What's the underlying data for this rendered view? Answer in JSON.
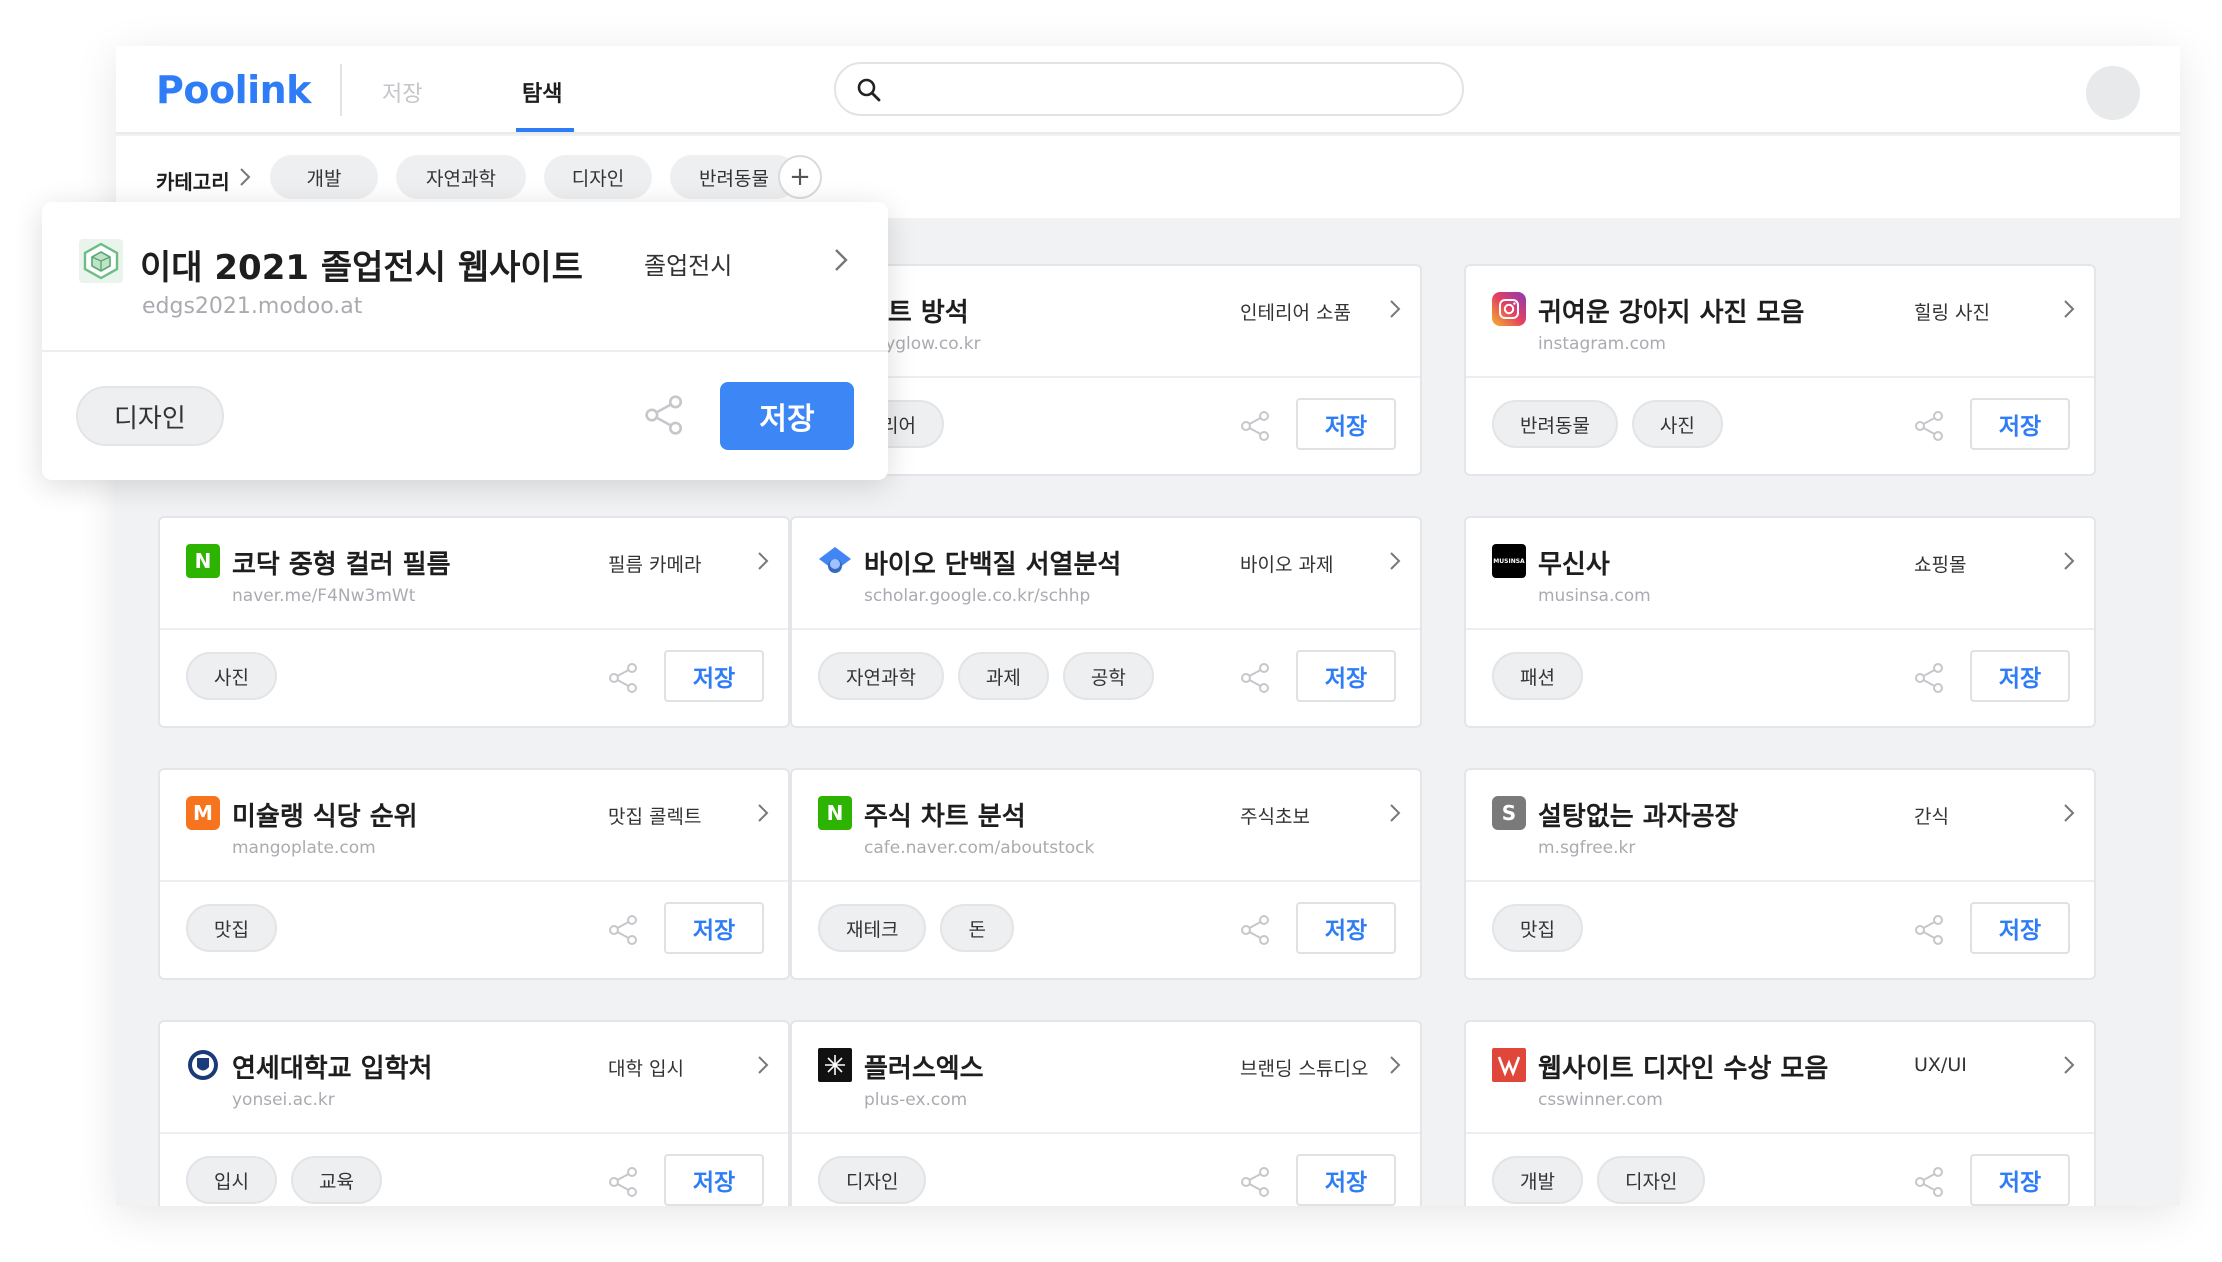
{
  "header": {
    "logo": "Poolink",
    "tabs": {
      "save": "저장",
      "explore": "탐색"
    },
    "search_placeholder": ""
  },
  "category_bar": {
    "label": "카테고리",
    "pills": [
      "개발",
      "자연과학",
      "디자인",
      "반려동물"
    ],
    "add_label": "+"
  },
  "popup": {
    "title": "이대 2021 졸업전시 웹사이트",
    "url": "edgs2021.modoo.at",
    "category": "졸업전시",
    "tag": "디자인",
    "save_label": "저장"
  },
  "cards": [
    {
      "title": "보트 방석",
      "url": "dayglow.co.kr",
      "category": "인테리어 소품",
      "tags": [
        "인테리어"
      ],
      "save": "저장"
    },
    {
      "title": "귀여운 강아지 사진 모음",
      "url": "instagram.com",
      "category": "힐링 사진",
      "tags": [
        "반려동물",
        "사진"
      ],
      "save": "저장"
    },
    {
      "title": "코닥 중형 컬러 필름",
      "url": "naver.me/F4Nw3mWt",
      "category": "필름 카메라",
      "tags": [
        "사진"
      ],
      "save": "저장",
      "icon_text": "N"
    },
    {
      "title": "바이오 단백질 서열분석",
      "url": "scholar.google.co.kr/schhp",
      "category": "바이오 과제",
      "tags": [
        "자연과학",
        "과제",
        "공학"
      ],
      "save": "저장"
    },
    {
      "title": "무신사",
      "url": "musinsa.com",
      "category": "쇼핑몰",
      "tags": [
        "패션"
      ],
      "save": "저장",
      "icon_text": "MUSINSA"
    },
    {
      "title": "미슐랭 식당 순위",
      "url": "mangoplate.com",
      "category": "맛집 콜렉트",
      "tags": [
        "맛집"
      ],
      "save": "저장",
      "icon_text": "M"
    },
    {
      "title": "주식 차트 분석",
      "url": "cafe.naver.com/aboutstock",
      "category": "주식초보",
      "tags": [
        "재테크",
        "돈"
      ],
      "save": "저장",
      "icon_text": "N"
    },
    {
      "title": "설탕없는 과자공장",
      "url": "m.sgfree.kr",
      "category": "간식",
      "tags": [
        "맛집"
      ],
      "save": "저장",
      "icon_text": "S"
    },
    {
      "title": "연세대학교 입학처",
      "url": "yonsei.ac.kr",
      "category": "대학 입시",
      "tags": [
        "입시",
        "교육"
      ],
      "save": "저장"
    },
    {
      "title": "플러스엑스",
      "url": "plus-ex.com",
      "category": "브랜딩 스튜디오",
      "tags": [
        "디자인"
      ],
      "save": "저장"
    },
    {
      "title": "웹사이트 디자인 수상 모음",
      "url": "csswinner.com",
      "category": "UX/UI",
      "tags": [
        "개발",
        "디자인"
      ],
      "save": "저장"
    }
  ],
  "colors": {
    "accent": "#2f7df6",
    "background": "#f1f2f4",
    "naver": "#2db400",
    "mango": "#f7741f",
    "sgfree": "#7a7a7a"
  }
}
